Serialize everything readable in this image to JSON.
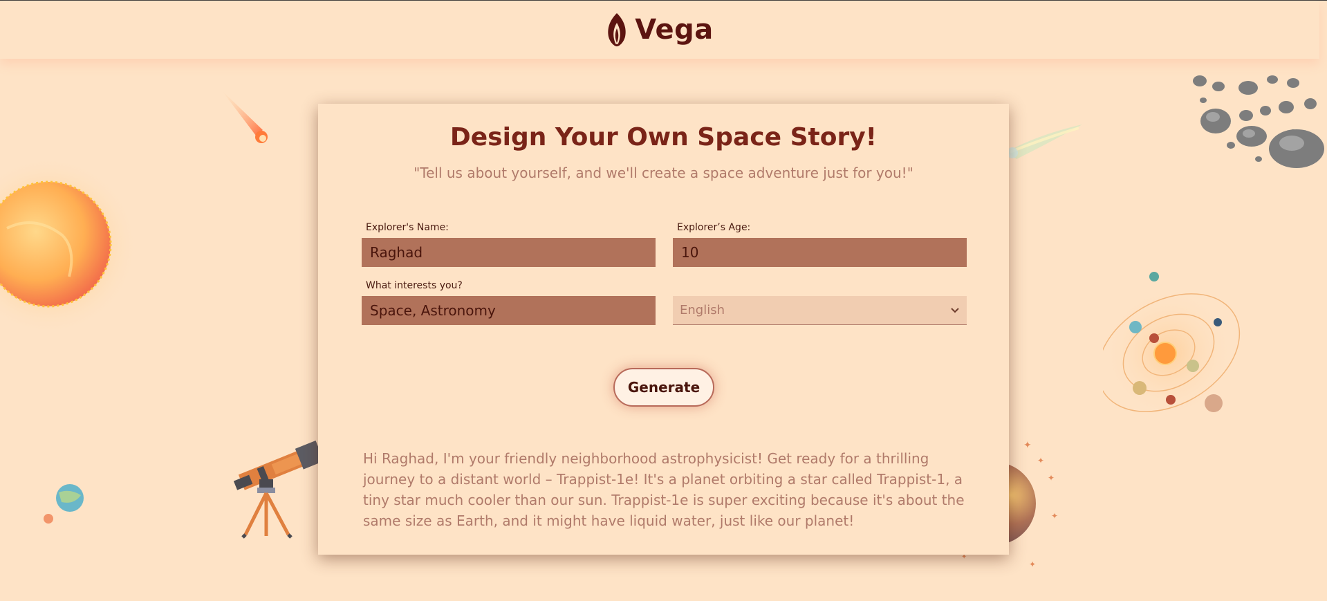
{
  "brand": {
    "name": "Vega",
    "logo_icon": "flame-logo-icon"
  },
  "form": {
    "title": "Design Your Own Space Story!",
    "subtitle": "\"Tell us about yourself, and we'll create a space adventure just for you!\"",
    "name_label": "Explorer's Name:",
    "name_value": "Raghad",
    "age_label": "Explorer’s Age:",
    "age_value": "10",
    "interests_label": "What interests you?",
    "interests_value": "Space, Astronomy",
    "language_value": "English",
    "generate_label": "Generate"
  },
  "story": {
    "text": "Hi Raghad, I'm your friendly neighborhood astrophysicist! Get ready for a thrilling journey to a distant world – Trappist-1e! It's a planet orbiting a star called Trappist-1, a tiny star much cooler than our sun. Trappist-1e is super exciting because it's about the same size as Earth, and it might have liquid water, just like our planet!"
  },
  "colors": {
    "background": "#fee3c6",
    "input_fill": "#b1725a",
    "title": "#7a2418",
    "muted_text": "#b07a6a"
  }
}
